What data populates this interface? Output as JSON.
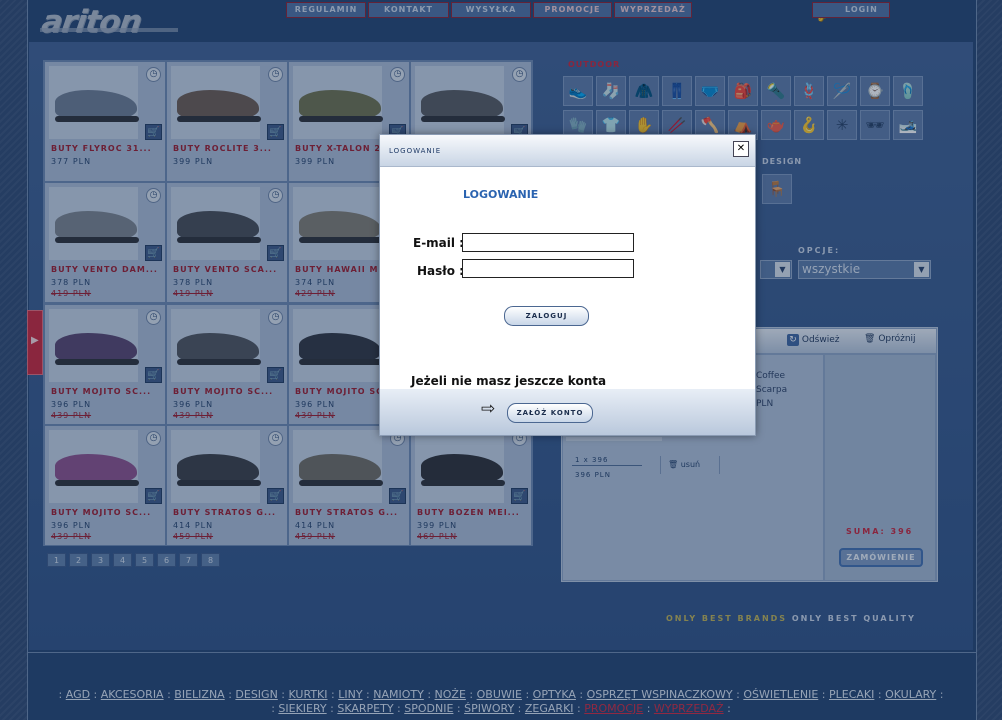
{
  "site": {
    "logo": "ariton"
  },
  "topnav": [
    {
      "label": "REGULAMIN",
      "highlight": false
    },
    {
      "label": "KONTAKT",
      "highlight": false
    },
    {
      "label": "WYSYŁKA",
      "highlight": false
    },
    {
      "label": "PROMOCJE",
      "highlight": true
    },
    {
      "label": "WYPRZEDAŻ",
      "highlight": true
    }
  ],
  "login_button": "LOGIN",
  "products": [
    {
      "name": "BUTY FLYROC 31...",
      "price": "377 PLN",
      "old_price": "",
      "color": "#6b7a91"
    },
    {
      "name": "BUTY ROCLITE 3...",
      "price": "399 PLN",
      "old_price": "",
      "color": "#6a5a50"
    },
    {
      "name": "BUTY X-TALON 2...",
      "price": "399 PLN",
      "old_price": "",
      "color": "#6c6f4e"
    },
    {
      "name": "",
      "price": "",
      "old_price": "",
      "color": "#55585f"
    },
    {
      "name": "BUTY VENTO DAM...",
      "price": "378 PLN",
      "old_price": "419 PLN",
      "color": "#7a828c"
    },
    {
      "name": "BUTY VENTO SCA...",
      "price": "378 PLN",
      "old_price": "419 PLN",
      "color": "#454a54"
    },
    {
      "name": "BUTY HAWAII ME...",
      "price": "374 PLN",
      "old_price": "429 PLN",
      "color": "#7f7b72"
    },
    {
      "name": "",
      "price": "",
      "old_price": "",
      "color": "#55585f"
    },
    {
      "name": "BUTY MOJITO SC...",
      "price": "396 PLN",
      "old_price": "439 PLN",
      "color": "#56436d"
    },
    {
      "name": "BUTY MOJITO SC...",
      "price": "396 PLN",
      "old_price": "439 PLN",
      "color": "#4d525b"
    },
    {
      "name": "BUTY MOJITO SC...",
      "price": "396 PLN",
      "old_price": "439 PLN",
      "color": "#2f3440"
    },
    {
      "name": "",
      "price": "",
      "old_price": "",
      "color": "#55585f"
    },
    {
      "name": "BUTY MOJITO SC...",
      "price": "396 PLN",
      "old_price": "439 PLN",
      "color": "#8a4f8a"
    },
    {
      "name": "BUTY STRATOS G...",
      "price": "414 PLN",
      "old_price": "459 PLN",
      "color": "#393c44"
    },
    {
      "name": "BUTY STRATOS G...",
      "price": "414 PLN",
      "old_price": "459 PLN",
      "color": "#6d6b63"
    },
    {
      "name": "BUTY BOZEN MEI...",
      "price": "399 PLN",
      "old_price": "469 PLN",
      "color": "#2b2d33"
    }
  ],
  "pagination": [
    "1",
    "2",
    "3",
    "4",
    "5",
    "6",
    "7",
    "8"
  ],
  "outdoor_label": "OUTDOOR",
  "design_label": "DESIGN",
  "options_label": "OPCJE:",
  "options_select": "wszystkie",
  "categories_row1": [
    "👟",
    "🧦",
    "🧥",
    "👖",
    "🩲",
    "🎒",
    "🔦",
    "🪢",
    "🪡",
    "⌚",
    "🩴"
  ],
  "categories_row2": [
    "🧤",
    "👕",
    "✋",
    "🥢",
    "🪓",
    "⛺",
    "🫖",
    "🪝",
    "✳",
    "🕶",
    "🎿"
  ],
  "cart": {
    "refresh_label": "Odśwież",
    "empty_label": "Opróżnij",
    "item_lines": [
      "Coffee",
      "Scarpa",
      "PLN"
    ],
    "qty_line": "1 x 396",
    "line_price": "396 PLN",
    "remove_label": "usuń",
    "sum_label": "SUMA: 396",
    "order_button": "ZAMÓWIENIE"
  },
  "brands": {
    "part1": "ONLY BEST BRANDS",
    "part2": "ONLY BEST QUALITY"
  },
  "footer": {
    "row1": [
      "AGD",
      "AKCESORIA",
      "BIELIZNA",
      "DESIGN",
      "KURTKI",
      "LINY",
      "NAMIOTY",
      "NOŻE",
      "OBUWIE",
      "OPTYKA",
      "OSPRZĘT WSPINACZKOWY",
      "OŚWIETLENIE",
      "PLECAKI",
      "OKULARY"
    ],
    "row2": [
      "SIEKIERY",
      "SKARPETY",
      "SPODNIE",
      "ŚPIWORY",
      "ZEGARKI"
    ],
    "row2_red": [
      "PROMOCJE",
      "WYPRZEDAŻ"
    ]
  },
  "modal": {
    "title": "LOGOWANIE",
    "heading": "LOGOWANIE",
    "email_label": "E-mail :",
    "email_value": "",
    "password_label": "Hasło :",
    "password_value": "",
    "login_button": "ZALOGUJ",
    "no_account_text": "Jeżeli nie masz jeszcze konta",
    "register_button": "ZAŁÓŻ KONTO",
    "close": "✕"
  },
  "colors": {
    "accent_red": "#c7243a",
    "brand_blue": "#234270"
  }
}
